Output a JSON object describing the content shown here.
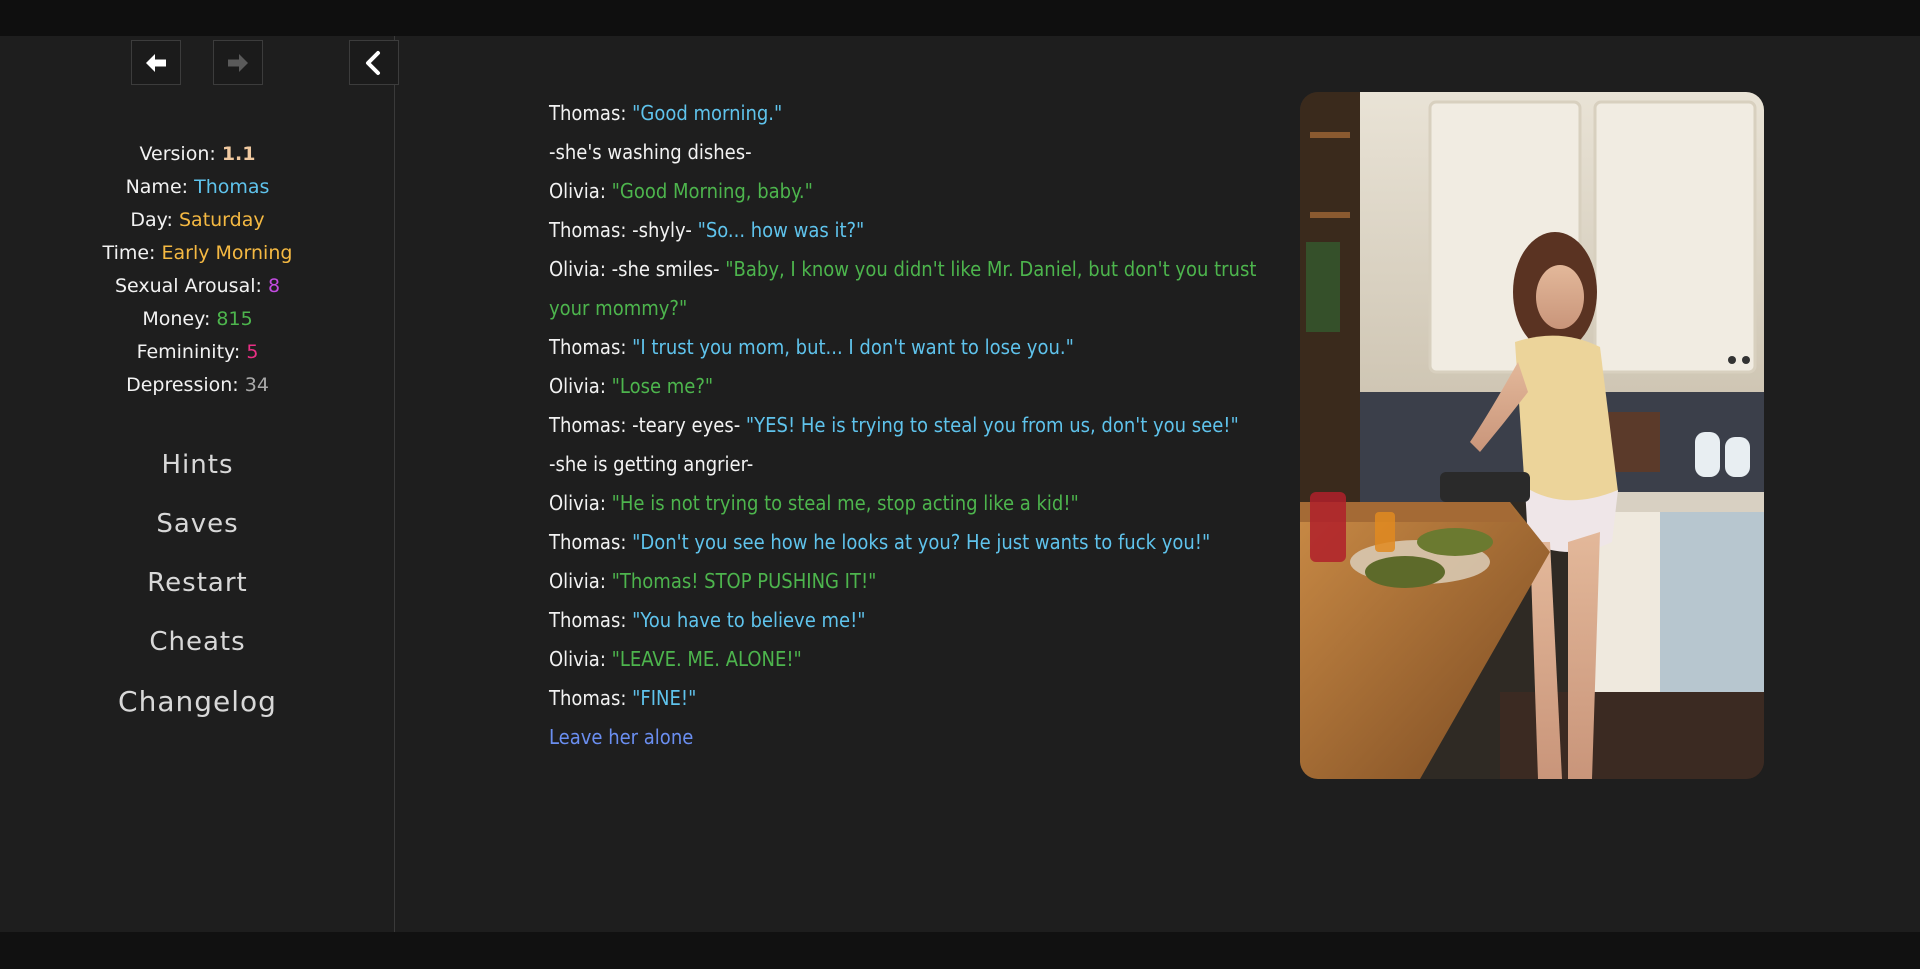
{
  "nav": {
    "back_icon": "arrow-left-icon",
    "forward_icon": "arrow-right-icon",
    "collapse_icon": "chevron-left-icon"
  },
  "stats": [
    {
      "label": "Version:",
      "value": "1.1",
      "color": "#f0c9a0",
      "bold": true
    },
    {
      "label": "Name:",
      "value": "Thomas",
      "color": "#5fc3ec"
    },
    {
      "label": "Day:",
      "value": "Saturday",
      "color": "#f5b942"
    },
    {
      "label": "Time:",
      "value": "Early Morning",
      "color": "#f5b942"
    },
    {
      "label": "Sexual Arousal:",
      "value": "8",
      "color": "#c24be0"
    },
    {
      "label": "Money:",
      "value": "815",
      "color": "#4db54d"
    },
    {
      "label": "Femininity:",
      "value": "5",
      "color": "#ea2f85"
    },
    {
      "label": "Depression:",
      "value": "34",
      "color": "#a9a9a9"
    }
  ],
  "menu": [
    "Hints",
    "Saves",
    "Restart",
    "Cheats",
    "Changelog"
  ],
  "story": [
    {
      "speaker": "Thomas:",
      "action": "",
      "quote": "\"Good morning.\"",
      "who": "thomas"
    },
    {
      "speaker": "",
      "action": "-she's washing dishes-",
      "quote": "",
      "who": "none"
    },
    {
      "speaker": "Olivia:",
      "action": "",
      "quote": "\"Good Morning, baby.\"",
      "who": "olivia"
    },
    {
      "speaker": "Thomas:",
      "action": "-shyly-",
      "quote": "\"So... how was it?\"",
      "who": "thomas"
    },
    {
      "speaker": "Olivia:",
      "action": "-she smiles-",
      "quote": "\"Baby, I know you didn't like Mr. Daniel, but don't you trust your mommy?\"",
      "who": "olivia"
    },
    {
      "speaker": "Thomas:",
      "action": "",
      "quote": "\"I trust you mom, but... I don't want to lose you.\"",
      "who": "thomas"
    },
    {
      "speaker": "Olivia:",
      "action": "",
      "quote": "\"Lose me?\"",
      "who": "olivia"
    },
    {
      "speaker": "Thomas:",
      "action": "-teary eyes-",
      "quote": "\"YES! He is trying to steal you from us, don't you see!\"",
      "who": "thomas"
    },
    {
      "speaker": "",
      "action": "-she is getting angrier-",
      "quote": "",
      "who": "none"
    },
    {
      "speaker": "Olivia:",
      "action": "",
      "quote": "\"He is not trying to steal me, stop acting like a kid!\"",
      "who": "olivia"
    },
    {
      "speaker": "Thomas:",
      "action": "",
      "quote": "\"Don't you see how he looks at you? He just wants to fuck you!\"",
      "who": "thomas"
    },
    {
      "speaker": "Olivia:",
      "action": "",
      "quote": "\"Thomas! STOP PUSHING IT!\"",
      "who": "olivia"
    },
    {
      "speaker": "Thomas:",
      "action": "",
      "quote": "\"You have to believe me!\"",
      "who": "thomas"
    },
    {
      "speaker": "Olivia:",
      "action": "",
      "quote": "\"LEAVE. ME. ALONE!\"",
      "who": "olivia"
    },
    {
      "speaker": "Thomas:",
      "action": "",
      "quote": "\"FINE!\"",
      "who": "thomas"
    }
  ],
  "choice": "Leave her alone",
  "colors": {
    "thomas": "#5fc3ec",
    "olivia": "#4db54d",
    "link": "#6a8ef0",
    "background": "#1e1e1e"
  }
}
